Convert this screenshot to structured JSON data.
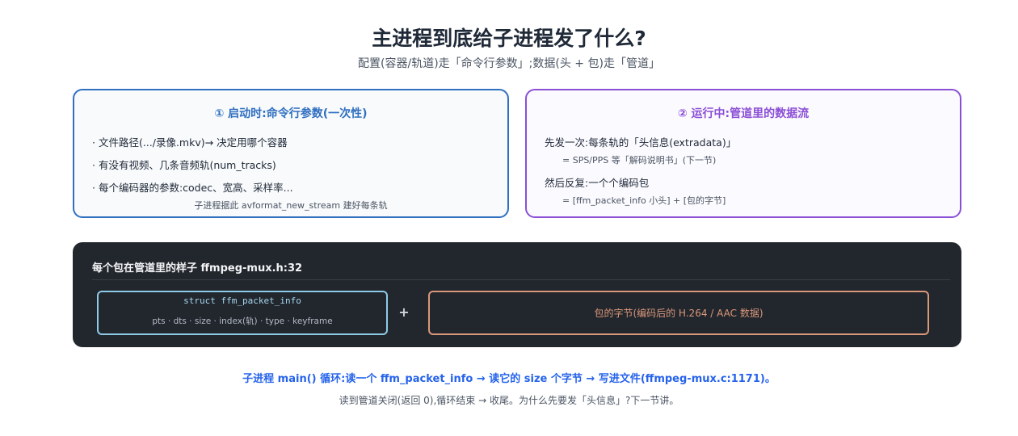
{
  "header": {
    "title": "主进程到底给子进程发了什么?",
    "subtitle": "配置(容器/轨道)走「命令行参数」;数据(头 + 包)走「管道」"
  },
  "left_card": {
    "title": "① 启动时:命令行参数(一次性)",
    "items": [
      "· 文件路径(.../录像.mkv)→ 决定用哪个容器",
      "· 有没有视频、几条音频轨(num_tracks)",
      "· 每个编码器的参数:codec、宽高、采样率..."
    ],
    "footer": "子进程据此 avformat_new_stream 建好每条轨"
  },
  "right_card": {
    "title": "② 运行中:管道里的数据流",
    "first_line": "先发一次:每条轨的「头信息(extradata)」",
    "first_sub": "= SPS/PPS 等「解码说明书」(下一节)",
    "second_line": "然后反复:一个个编码包",
    "second_sub": "= [ffm_packet_info 小头] + [包的字节]"
  },
  "panel": {
    "title": "每个包在管道里的样子  ffmpeg-mux.h:32",
    "struct_name": "struct ffm_packet_info",
    "struct_fields": "pts · dts · size · index(轨) · type · keyframe",
    "plus": "+",
    "bytes_label": "包的字节(编码后的 H.264 / AAC 数据)"
  },
  "footer": {
    "line1": "子进程 main() 循环:读一个 ffm_packet_info → 读它的 size 个字节 → 写进文件(ffmpeg-mux.c:1171)。",
    "line2": "读到管道关闭(返回 0),循环结束 → 收尾。为什么先要发「头信息」?下一节讲。"
  },
  "colors": {
    "left_accent": "#2f6fc0",
    "right_accent": "#8b4fd6",
    "panel_bg": "#22262d",
    "struct_border": "#8ecbe6",
    "bytes_border": "#d9987a",
    "footer_accent": "#2563eb"
  }
}
